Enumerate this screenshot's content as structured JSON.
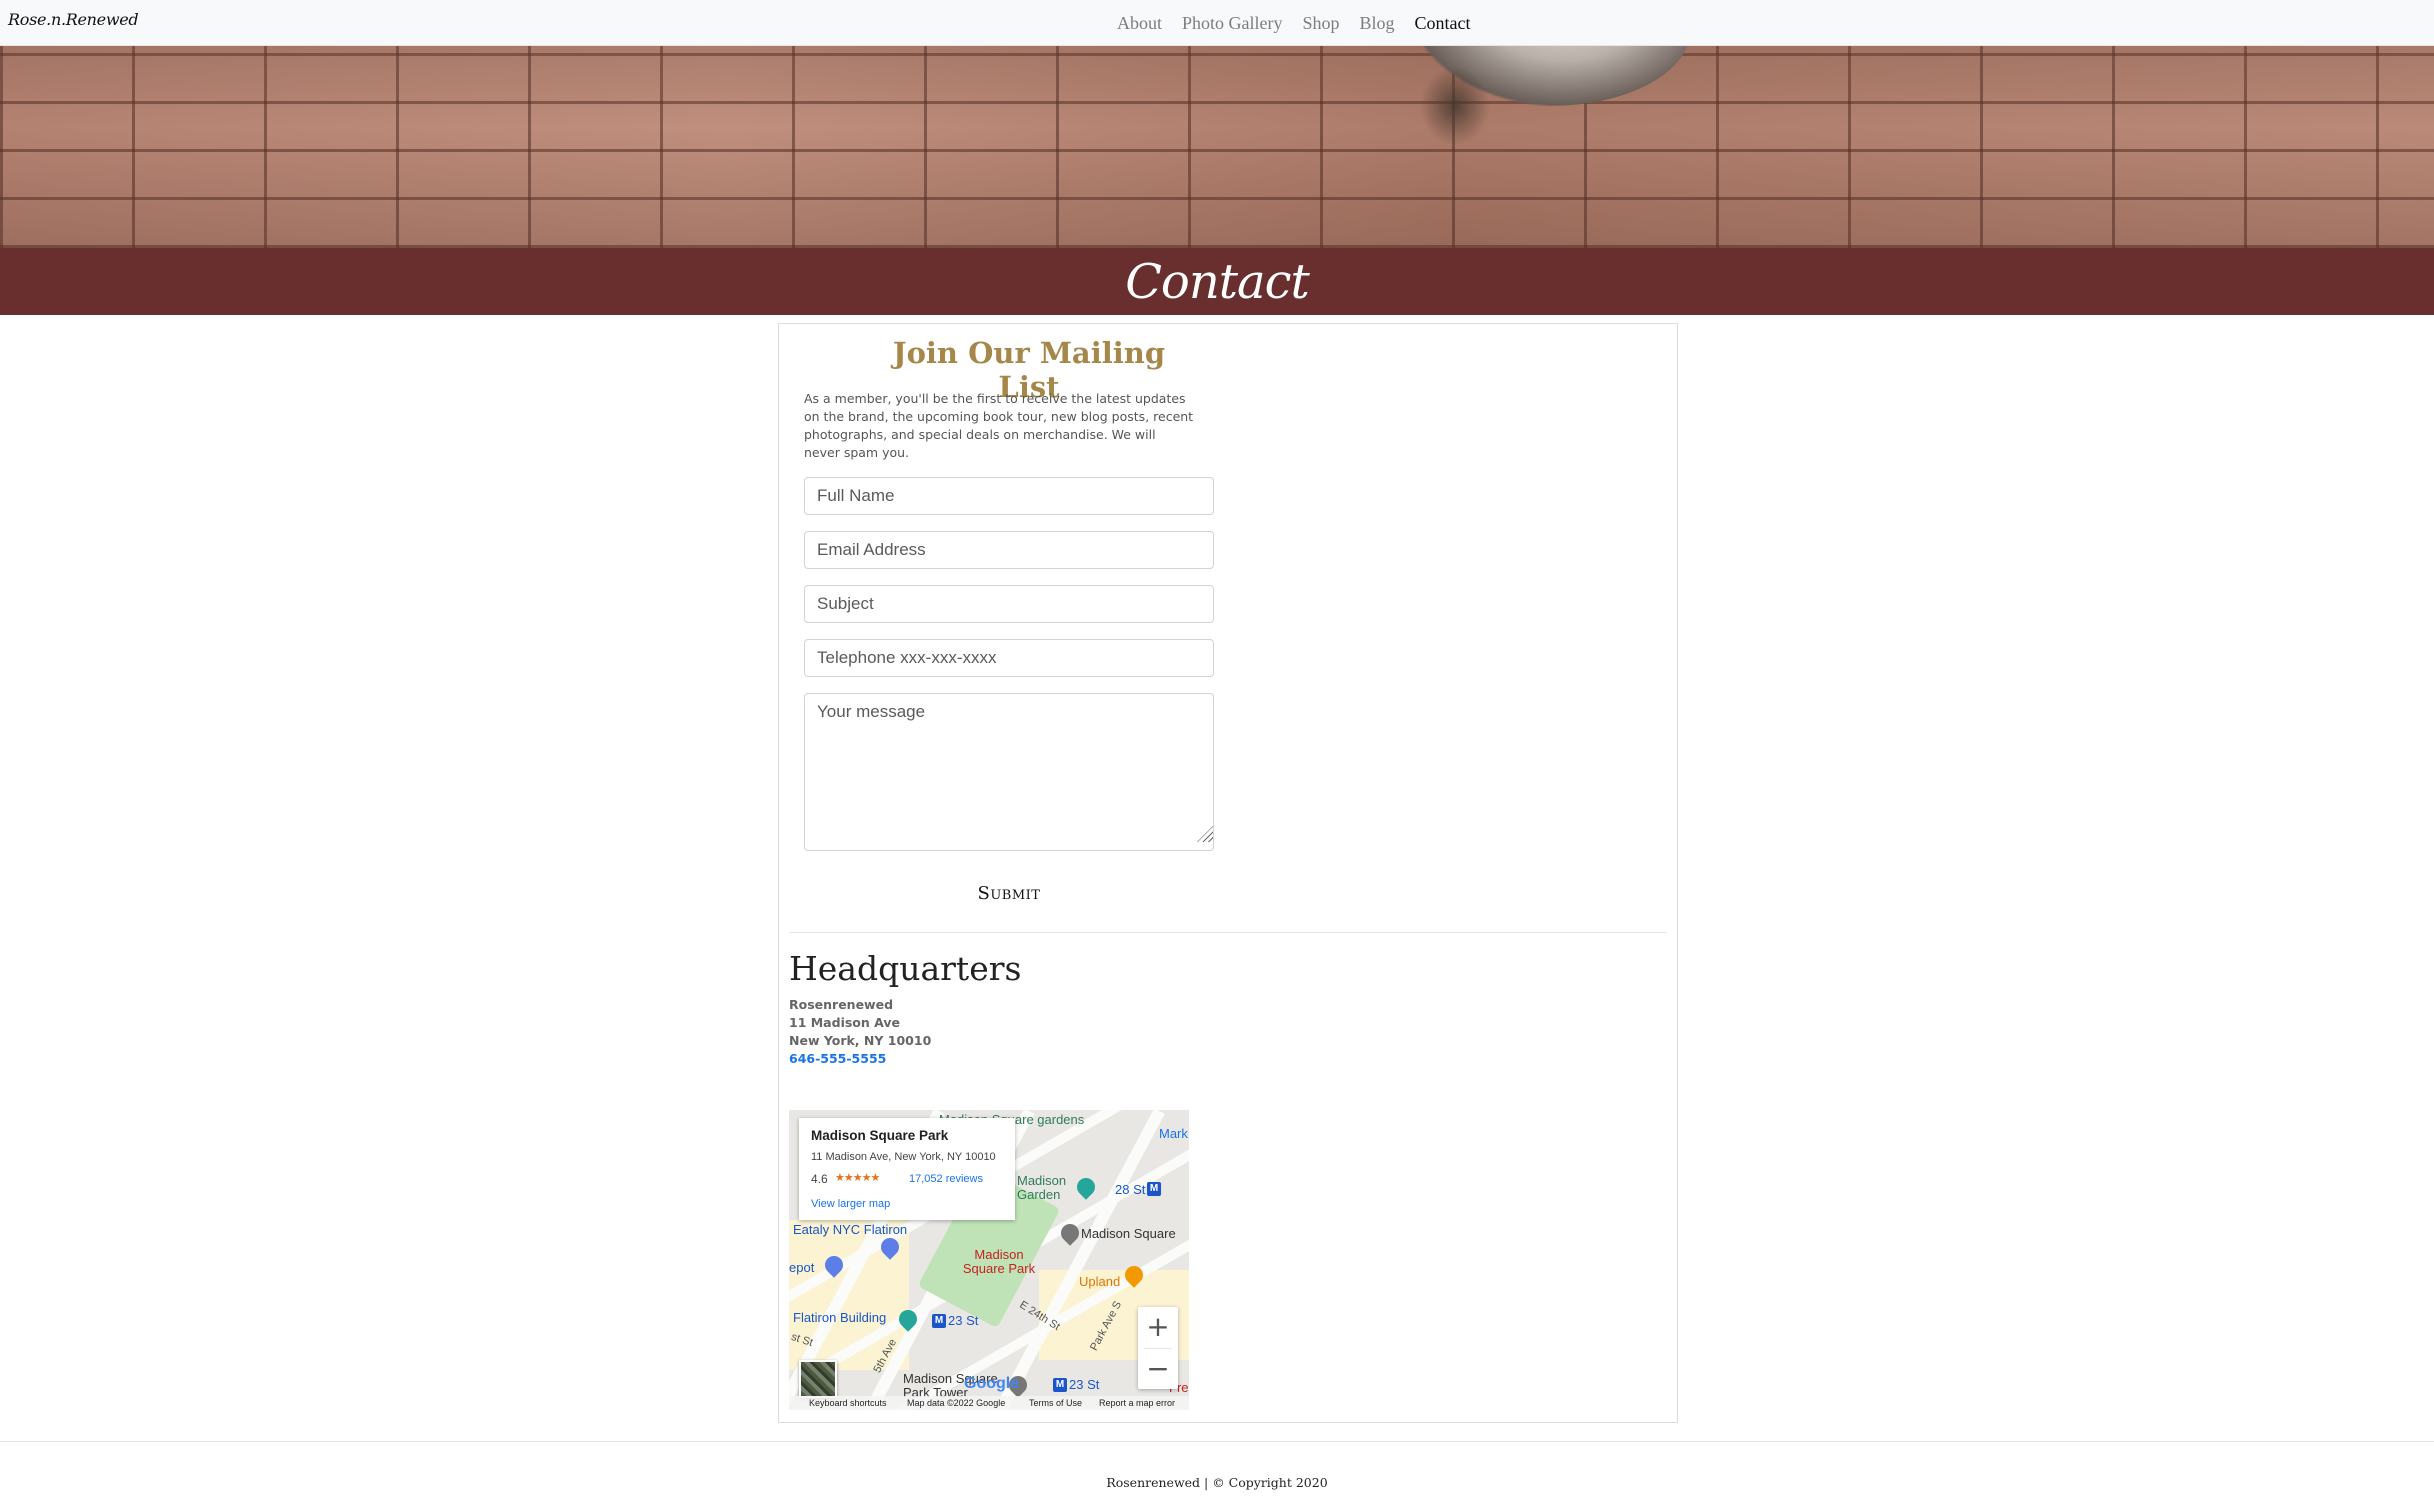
{
  "navbar": {
    "brand": "Rose.n.Renewed",
    "links": [
      "About",
      "Photo Gallery",
      "Shop",
      "Blog",
      "Contact"
    ],
    "active": "Contact"
  },
  "banner": {
    "title": "Contact"
  },
  "mailing": {
    "title": "Join Our Mailing List",
    "description": "As a member, you'll be the first to receive the latest updates on the brand, the upcoming book tour, new blog posts, recent photographs, and special deals on merchandise. We will never spam you.",
    "placeholders": {
      "name": "Full Name",
      "email": "Email Address",
      "subject": "Subject",
      "phone": "Telephone xxx-xxx-xxxx",
      "message": "Your message"
    },
    "submit_label": "Submit"
  },
  "hq": {
    "title": "Headquarters",
    "company": "Rosenrenewed",
    "street": "11 Madison Ave",
    "city": "New York, NY 10010",
    "phone": "646-555-5555"
  },
  "map": {
    "place_name": "Madison Square Park",
    "place_address": "11 Madison Ave, New York, NY 10010",
    "rating": "4.6",
    "stars": "★★★★★",
    "reviews": "17,052 reviews",
    "larger_map": "View larger map",
    "labels": {
      "gardens": "Madison Square gardens",
      "mark": "Mark",
      "garden": "Madison Garden",
      "st28": "28 St",
      "square": "Madison Square",
      "eataly": "Eataly NYC Flatiron",
      "depot": "epot",
      "park": "Madison Square Park",
      "upland": "Upland",
      "flatiron": "Flatiron Building",
      "st23a": "23 St",
      "e24": "E 24th St",
      "parkave": "Park Ave S",
      "fifth": "5th Ave",
      "st1": "st St",
      "tower": "Madison Square Park Tower",
      "st23b": "23 St",
      "fre": "Fre",
      "google": "Google"
    },
    "attribution": [
      "Keyboard shortcuts",
      "Map data ©2022 Google",
      "Terms of Use",
      "Report a map error"
    ],
    "zoom_in": "+",
    "zoom_out": "−"
  },
  "footer": {
    "text": "Rosenrenewed | © Copyright 2020"
  }
}
